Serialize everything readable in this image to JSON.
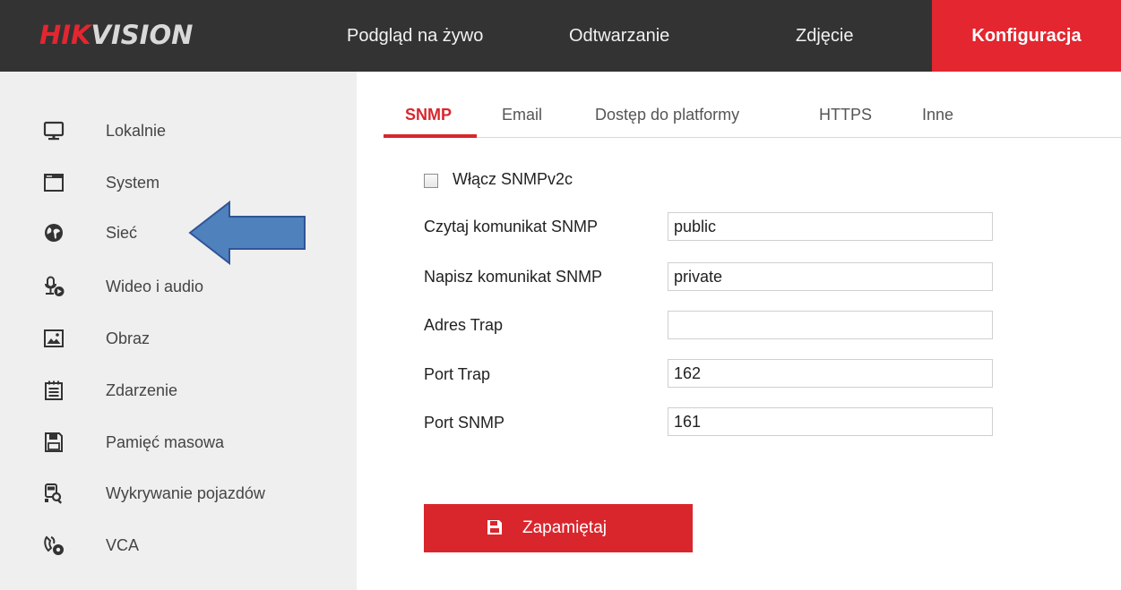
{
  "brand": {
    "part1": "HIK",
    "part2": "VISION"
  },
  "nav": {
    "live": "Podgląd na żywo",
    "playback": "Odtwarzanie",
    "picture": "Zdjęcie",
    "config": "Konfiguracja"
  },
  "sidebar": {
    "items": [
      {
        "label": "Lokalnie",
        "icon": "monitor-icon"
      },
      {
        "label": "System",
        "icon": "window-icon"
      },
      {
        "label": "Sieć",
        "icon": "globe-icon"
      },
      {
        "label": "Wideo i audio",
        "icon": "mic-video-icon"
      },
      {
        "label": "Obraz",
        "icon": "image-icon"
      },
      {
        "label": "Zdarzenie",
        "icon": "calendar-icon"
      },
      {
        "label": "Pamięć masowa",
        "icon": "floppy-icon"
      },
      {
        "label": "Wykrywanie pojazdów",
        "icon": "vehicle-search-icon"
      },
      {
        "label": "VCA",
        "icon": "vca-icon"
      }
    ]
  },
  "tabs": [
    "SNMP",
    "Email",
    "Dostęp do platformy",
    "HTTPS",
    "Inne"
  ],
  "form": {
    "enable_label": "Włącz SNMPv2c",
    "enable_checked": false,
    "read_label": "Czytaj komunikat SNMP",
    "read_value": "public",
    "write_label": "Napisz komunikat SNMP",
    "write_value": "private",
    "trap_addr_label": "Adres Trap",
    "trap_addr_value": "",
    "trap_port_label": "Port Trap",
    "trap_port_value": "162",
    "snmp_port_label": "Port SNMP",
    "snmp_port_value": "161"
  },
  "save_label": "Zapamiętaj",
  "colors": {
    "accent": "#d9262d",
    "topbar": "#333333",
    "sidebar": "#efefef",
    "arrow": "#4f81bd"
  }
}
